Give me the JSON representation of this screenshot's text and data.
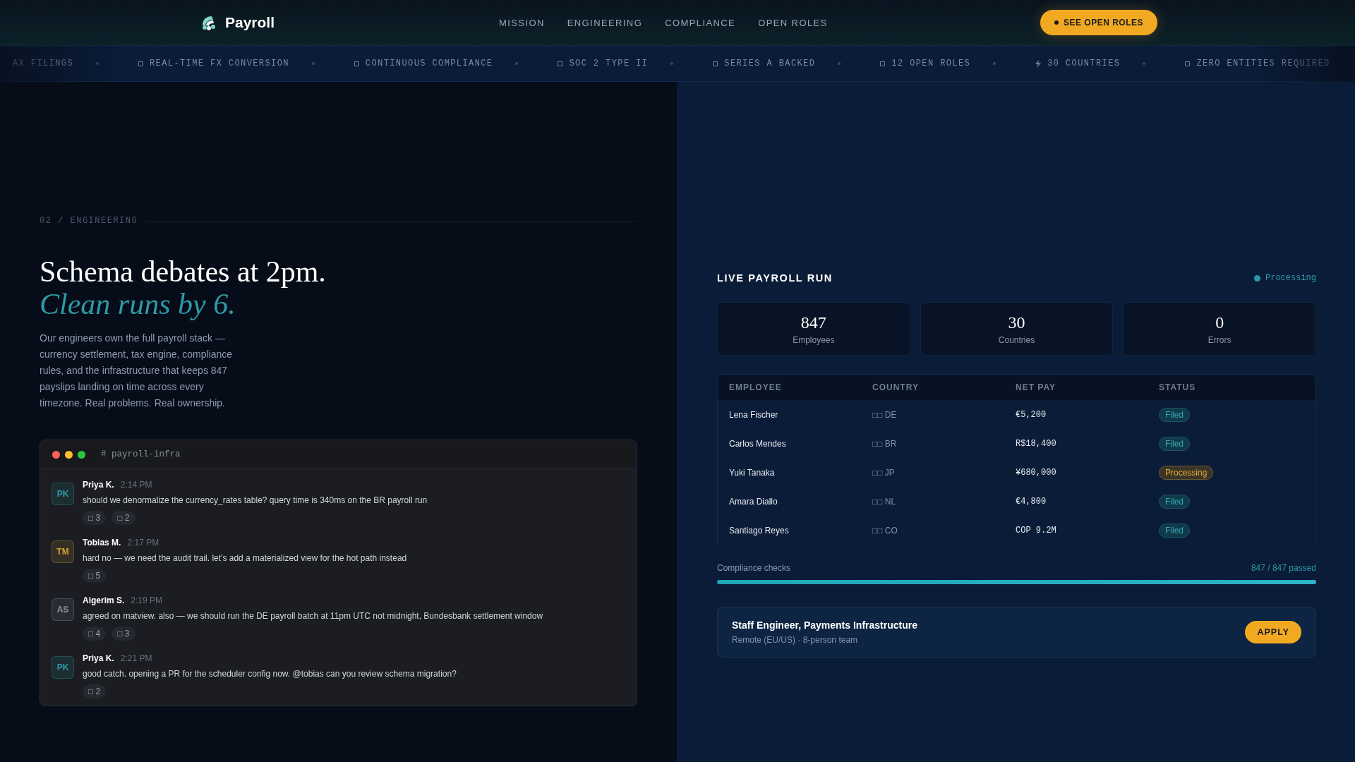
{
  "nav": {
    "logo": "Payroll",
    "links": [
      "MISSION",
      "ENGINEERING",
      "COMPLIANCE",
      "OPEN ROLES"
    ],
    "cta": "SEE OPEN ROLES"
  },
  "ticker": [
    {
      "text": "AX FILINGS",
      "kind": "plain"
    },
    {
      "text": "REAL-TIME FX CONVERSION",
      "kind": "square"
    },
    {
      "text": "CONTINUOUS COMPLIANCE",
      "kind": "square"
    },
    {
      "text": "SOC 2 TYPE II",
      "kind": "square"
    },
    {
      "text": "SERIES A BACKED",
      "kind": "square"
    },
    {
      "text": "12 OPEN ROLES",
      "kind": "square"
    },
    {
      "text": "30 COUNTRIES",
      "kind": "bolt"
    },
    {
      "text": "ZERO ENTITIES REQUIRED",
      "kind": "square"
    }
  ],
  "hero": {
    "eyebrow": "02 / ENGINEERING",
    "title": "Schema debates at 2pm.",
    "title_accent": "Clean runs by 6.",
    "body": "Our engineers own the full payroll stack — currency settlement, tax engine, compliance rules, and the infrastructure that keeps 847 payslips landing on time across every timezone. Real problems. Real ownership."
  },
  "chat": {
    "channel": "# payroll-infra",
    "messages": [
      {
        "initials": "PK",
        "color": "#2a9aa8",
        "name": "Priya K.",
        "time": "2:14 PM",
        "text": "should we denormalize the currency_rates table? query time is 340ms on the BR payroll run",
        "reactions": [
          "□ 3",
          "□ 2"
        ]
      },
      {
        "initials": "TM",
        "color": "#d4a23a",
        "name": "Tobias M.",
        "time": "2:17 PM",
        "text": "hard no — we need the audit trail. let's add a materialized view for the hot path instead",
        "reactions": [
          "□ 5"
        ]
      },
      {
        "initials": "AS",
        "color": "#8a93a6",
        "name": "Aigerim S.",
        "time": "2:19 PM",
        "text": "agreed on matview. also — we should run the DE payroll batch at 11pm UTC not midnight, Bundesbank settlement window",
        "reactions": [
          "□ 4",
          "□ 3"
        ]
      },
      {
        "initials": "PK",
        "color": "#2a9aa8",
        "name": "Priya K.",
        "time": "2:21 PM",
        "text": "good catch. opening a PR for the scheduler config now. @tobias can you review schema migration?",
        "reactions": [
          "□ 2"
        ]
      }
    ]
  },
  "run": {
    "title": "LIVE PAYROLL RUN",
    "status": "Processing",
    "stats": [
      {
        "value": "847",
        "label": "Employees"
      },
      {
        "value": "30",
        "label": "Countries"
      },
      {
        "value": "0",
        "label": "Errors"
      }
    ],
    "table": {
      "columns": [
        "EMPLOYEE",
        "COUNTRY",
        "NET PAY",
        "STATUS"
      ],
      "rows": [
        {
          "employee": "Lena Fischer",
          "country": "□□ DE",
          "net_pay": "€5,200",
          "status": "Filed",
          "kind": "filed"
        },
        {
          "employee": "Carlos Mendes",
          "country": "□□ BR",
          "net_pay": "R$18,400",
          "status": "Filed",
          "kind": "filed"
        },
        {
          "employee": "Yuki Tanaka",
          "country": "□□ JP",
          "net_pay": "¥680,000",
          "status": "Processing",
          "kind": "processing"
        },
        {
          "employee": "Amara Diallo",
          "country": "□□ NL",
          "net_pay": "€4,800",
          "status": "Filed",
          "kind": "filed"
        },
        {
          "employee": "Santiago Reyes",
          "country": "□□ CO",
          "net_pay": "COP 9.2M",
          "status": "Filed",
          "kind": "filed"
        }
      ]
    },
    "compliance": {
      "label": "Compliance checks",
      "reading": "847 / 847 passed",
      "level": 1.0
    },
    "job": {
      "title": "Staff Engineer, Payments Infrastructure",
      "meta": "Remote (EU/US) · 8-person team",
      "button": "APPLY"
    }
  }
}
